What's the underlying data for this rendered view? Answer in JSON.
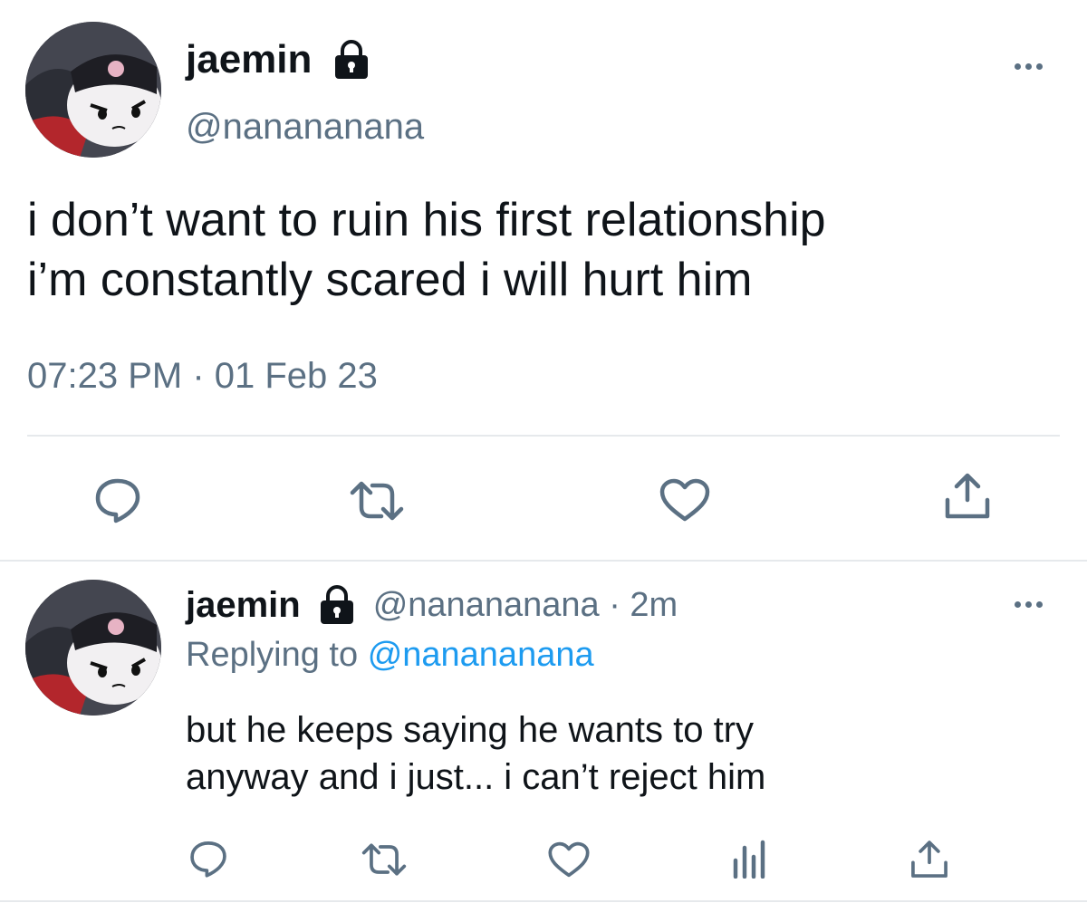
{
  "main_tweet": {
    "display_name": "jaemin",
    "handle": "@nanananana",
    "text_line1": "i don’t want to ruin his first relationship",
    "text_line2": "i’m constantly scared i will hurt him",
    "timestamp": "07:23 PM · 01 Feb 23",
    "lock_icon": "lock-icon",
    "actions": [
      "reply-icon",
      "retweet-icon",
      "like-icon",
      "share-icon"
    ]
  },
  "reply_tweet": {
    "display_name": "jaemin",
    "handle_time": "@nanananana · 2m",
    "replying_label": "Replying to",
    "replying_handle": "@nanananana",
    "text_line1": "but he keeps saying he wants to try",
    "text_line2": "anyway and i just... i can’t reject him",
    "actions": [
      "reply-icon",
      "retweet-icon",
      "like-icon",
      "analytics-icon",
      "share-icon"
    ]
  },
  "colors": {
    "text": "#0f1419",
    "secondary": "#5b7083",
    "link": "#1d9bf0",
    "divider": "#e6e9ec"
  }
}
